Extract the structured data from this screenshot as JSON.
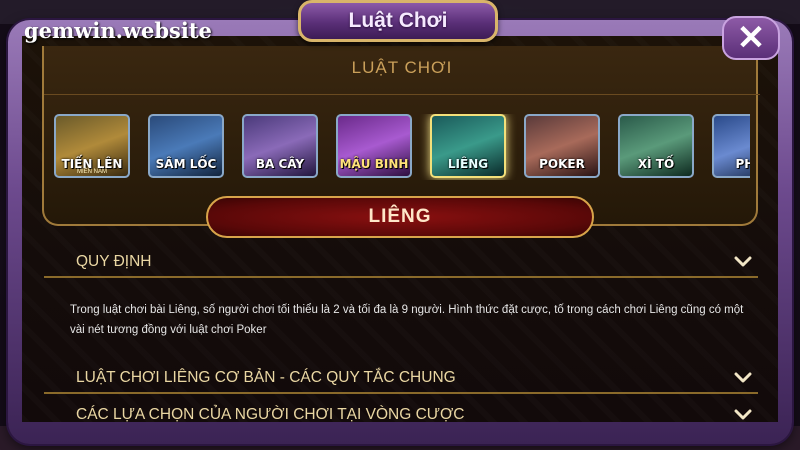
{
  "watermark": "gemwin.website",
  "dialog": {
    "title": "Luật Chơi",
    "close_label": "✕"
  },
  "games_panel": {
    "title": "LUẬT CHƠI",
    "games": [
      {
        "name": "TIẾN LÊN",
        "sub": "MIỀN NAM",
        "icon": "tien-len-thumbnail"
      },
      {
        "name": "SÂM LỐC",
        "sub": "",
        "icon": "sam-loc-thumbnail"
      },
      {
        "name": "BA CÂY",
        "sub": "",
        "icon": "ba-cay-thumbnail"
      },
      {
        "name": "MẬU BINH",
        "sub": "",
        "icon": "mau-binh-thumbnail"
      },
      {
        "name": "LIÊNG",
        "sub": "",
        "icon": "lieng-thumbnail",
        "active": true
      },
      {
        "name": "POKER",
        "sub": "",
        "icon": "poker-thumbnail"
      },
      {
        "name": "XÌ TỐ",
        "sub": "",
        "icon": "xi-to-thumbnail"
      },
      {
        "name": "PHỎ",
        "sub": "",
        "icon": "partial-thumbnail"
      }
    ]
  },
  "selected_game": "LIÊNG",
  "sections": [
    {
      "label": "QUY ĐỊNH",
      "content": "Trong luật chơi bài Liêng, số người chơi tối thiểu là 2 và tối đa là 9 người. Hình thức đặt cược, tố trong cách chơi Liêng cũng có một vài nét tương đồng với luật chơi Poker"
    },
    {
      "label": "LUẬT CHƠI LIÊNG CƠ BẢN - CÁC QUY TẮC CHUNG"
    },
    {
      "label": "CÁC LỰA CHỌN CỦA NGƯỜI CHƠI TẠI VÒNG CƯỢC"
    }
  ],
  "colors": {
    "frame_purple": "#6d4a8e",
    "gold": "#a07a3a",
    "banner_red": "#8a1010",
    "label_text": "#ead7a3"
  }
}
